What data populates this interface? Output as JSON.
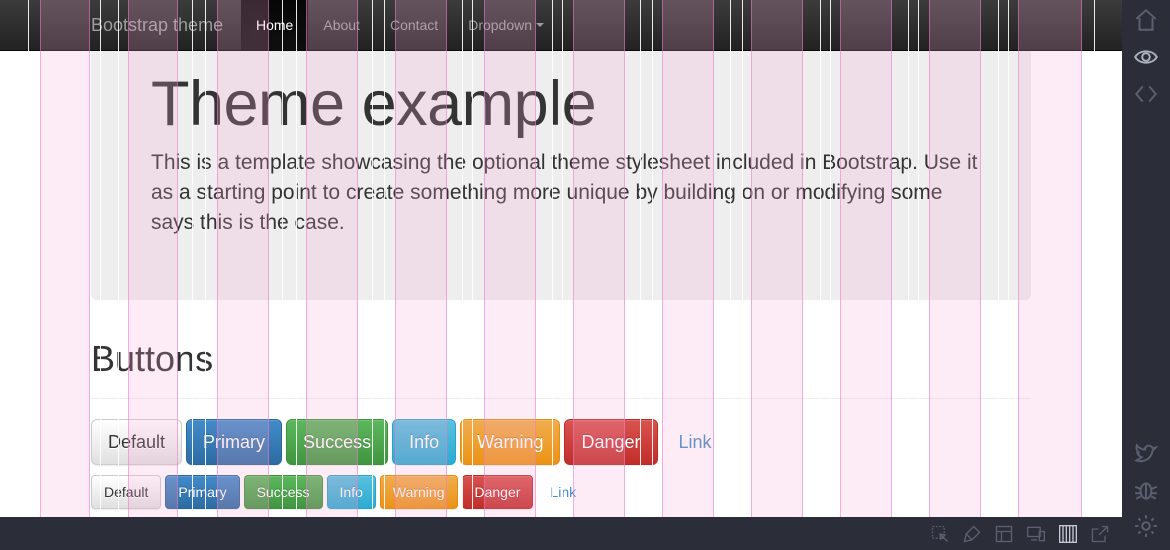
{
  "navbar": {
    "brand": "Bootstrap theme",
    "items": [
      {
        "label": "Home",
        "active": true
      },
      {
        "label": "About"
      },
      {
        "label": "Contact"
      },
      {
        "label": "Dropdown"
      }
    ]
  },
  "jumbotron": {
    "title": "Theme example",
    "text": "This is a template showcasing the optional theme stylesheet included in Bootstrap. Use it as a starting point to create something more unique by building on or modifying some says this is the case."
  },
  "buttons": {
    "heading": "Buttons",
    "large": [
      "Default",
      "Primary",
      "Success",
      "Info",
      "Warning",
      "Danger",
      "Link"
    ],
    "small": [
      "Default",
      "Primary",
      "Success",
      "Info",
      "Warning",
      "Danger",
      "Link"
    ]
  },
  "sidebar_icons": [
    "home-icon",
    "eye-icon",
    "code-icon",
    "twitter-icon",
    "bug-icon",
    "gear-icon"
  ],
  "bottom_tools": [
    "inspect-icon",
    "paint-icon",
    "layout-icon",
    "devices-icon",
    "grid-columns-icon",
    "external-link-icon"
  ],
  "colors": {
    "primary": "#428bca",
    "success": "#5cb85c",
    "info": "#5bc0de",
    "warning": "#f0ad4e",
    "danger": "#d9534f",
    "dark_chrome": "#2b2e38",
    "grid_overlay": "#f8aad2"
  }
}
